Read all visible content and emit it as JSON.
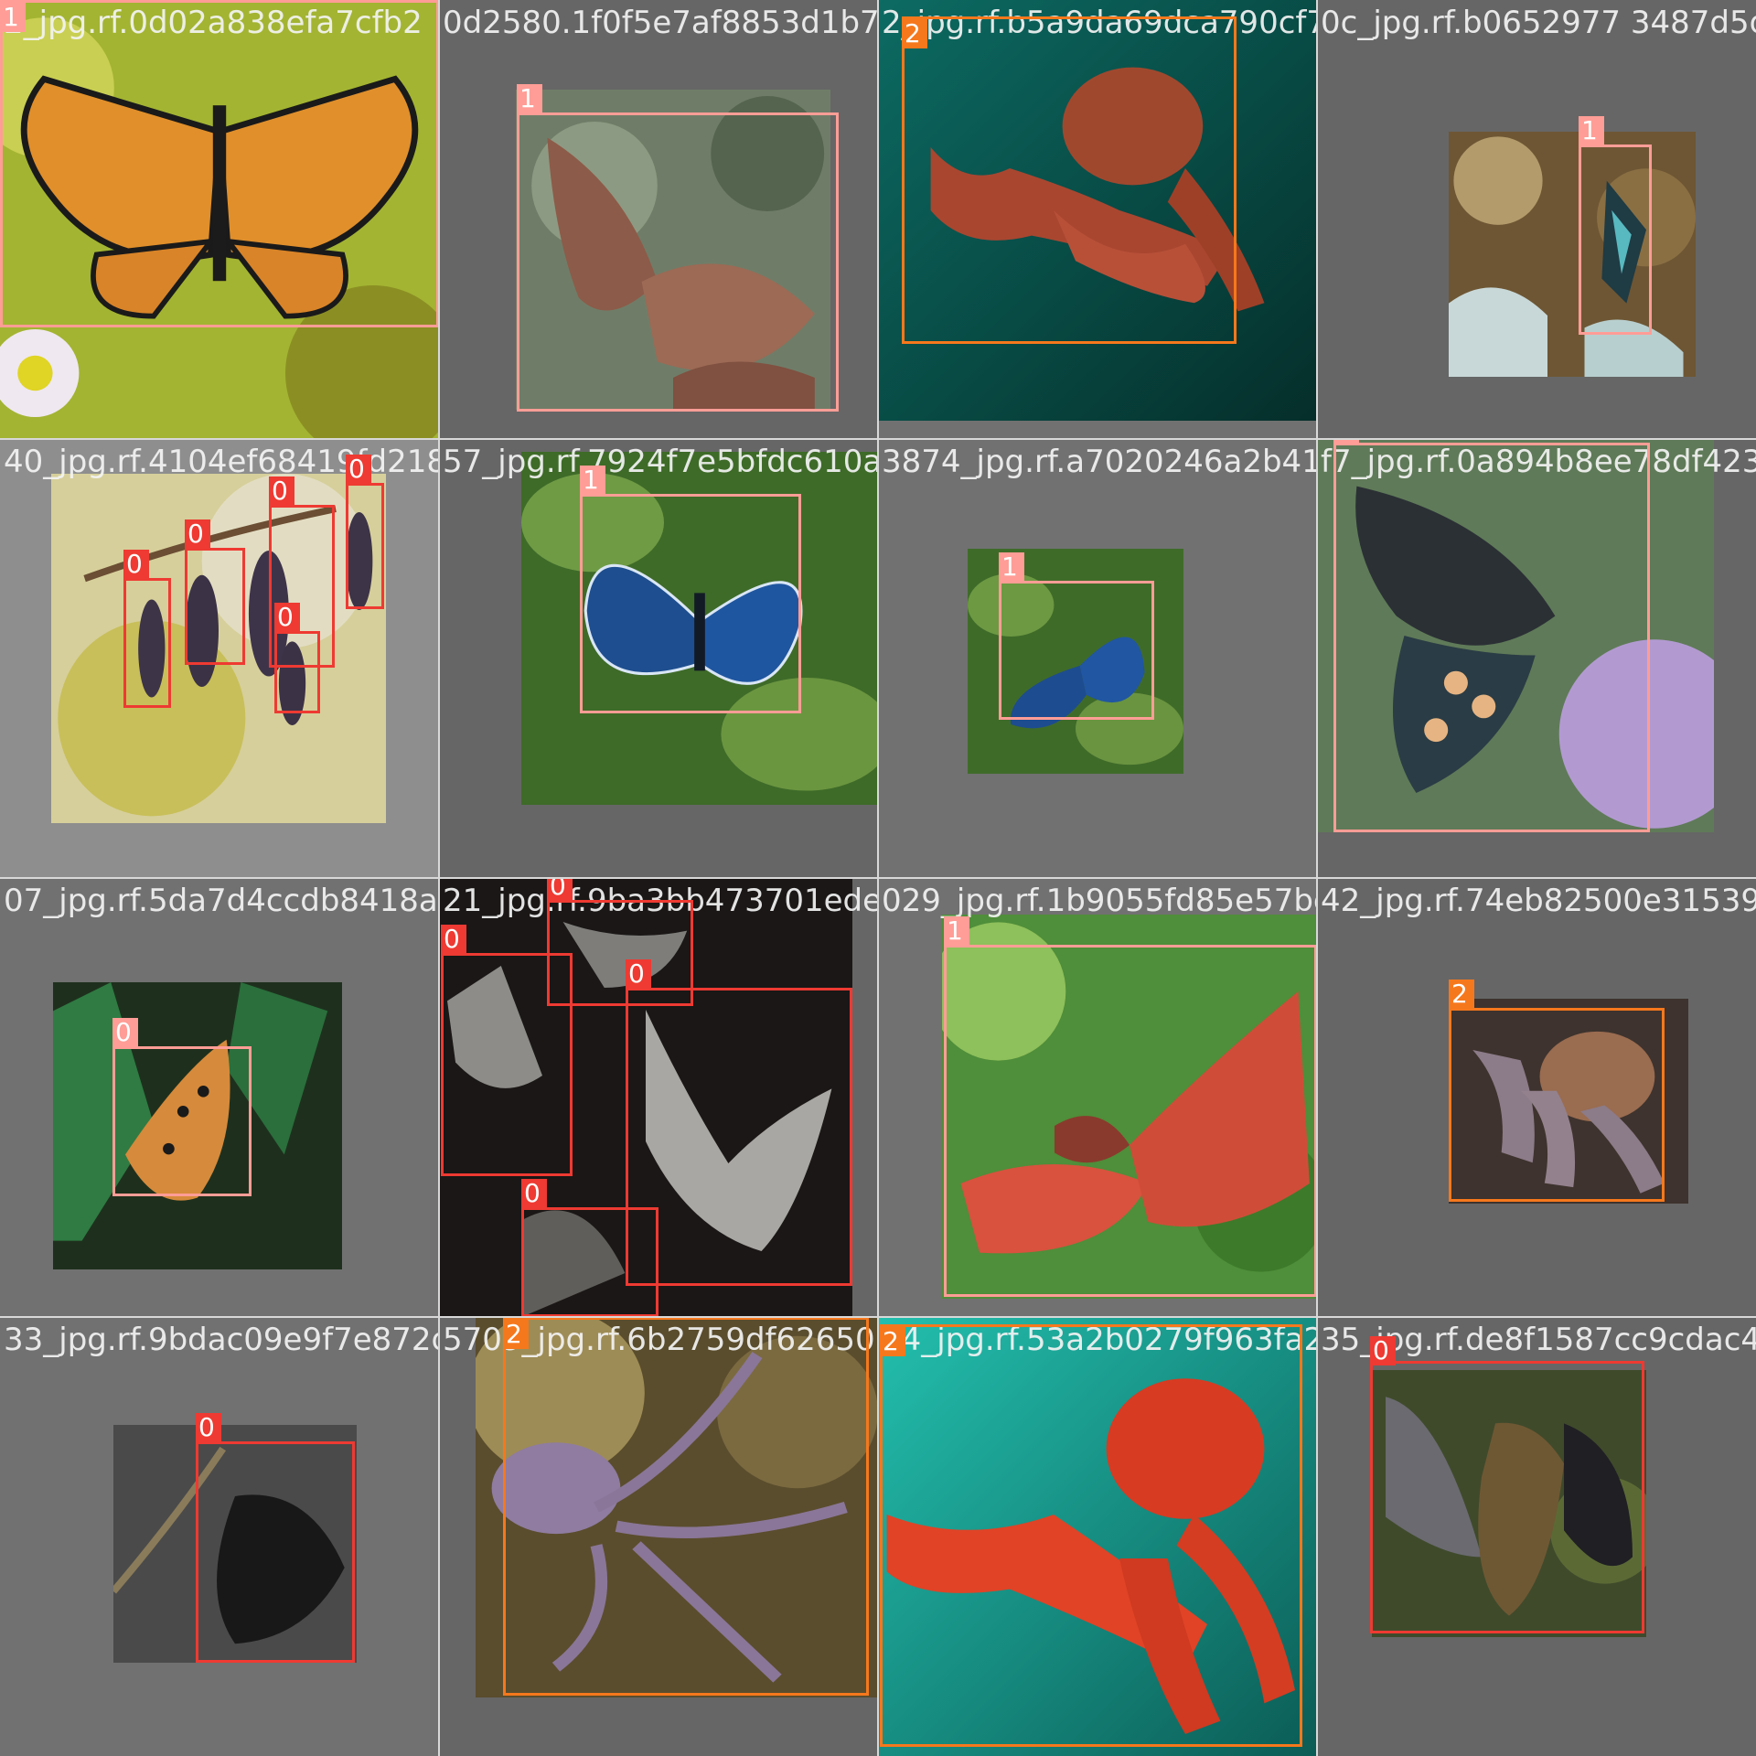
{
  "mosaic": {
    "tiles": [
      {
        "filename": "2_jpg.rf.0d02a838efa7cfb2",
        "labels": [
          "1"
        ]
      },
      {
        "filename": "0d2580.1f0f5e7af8853d1b7195",
        "labels": [
          "1"
        ]
      },
      {
        "filename": "2_jpg.rf.b5a9da69dca790cf70",
        "labels": [
          "2"
        ]
      },
      {
        "filename": "0c_jpg.rf.b0652977 3487d5d4",
        "labels": [
          "1"
        ]
      },
      {
        "filename": "40_jpg.rf.4104ef68419fd2185",
        "labels": [
          "0",
          "0",
          "0",
          "0",
          "0"
        ]
      },
      {
        "filename": "57_jpg.rf.7924f7e5bfdc610aa588",
        "labels": [
          "1"
        ]
      },
      {
        "filename": "3874_jpg.rf.a7020246a2b41229ef",
        "labels": [
          "1"
        ]
      },
      {
        "filename": "f7_jpg.rf.0a894b8ee78df4236a",
        "labels": [
          "1"
        ]
      },
      {
        "filename": "07_jpg.rf.5da7d4ccdb8418ae",
        "labels": [
          "0"
        ]
      },
      {
        "filename": "21_jpg.rf.9ba3bb473701ede6",
        "labels": [
          "0",
          "0",
          "0",
          "0"
        ]
      },
      {
        "filename": "029_jpg.rf.1b9055fd85e57bcd8a4",
        "labels": [
          "1"
        ]
      },
      {
        "filename": "42_jpg.rf.74eb82500e31539",
        "labels": [
          "2"
        ]
      },
      {
        "filename": "33_jpg.rf.9bdac09e9f7e872d",
        "labels": [
          "0"
        ]
      },
      {
        "filename": "5709_jpg.rf.6b2759df626503ee",
        "labels": [
          "2"
        ]
      },
      {
        "filename": "04_jpg.rf.53a2b0279f963fa2d",
        "labels": [
          "2"
        ]
      },
      {
        "filename": "35_jpg.rf.de8f1587cc9cdac47",
        "labels": [
          "0"
        ]
      }
    ]
  },
  "colors": {
    "class_0": "#ee3a32",
    "class_1": "#ff9d96",
    "class_2": "#f6781c"
  }
}
